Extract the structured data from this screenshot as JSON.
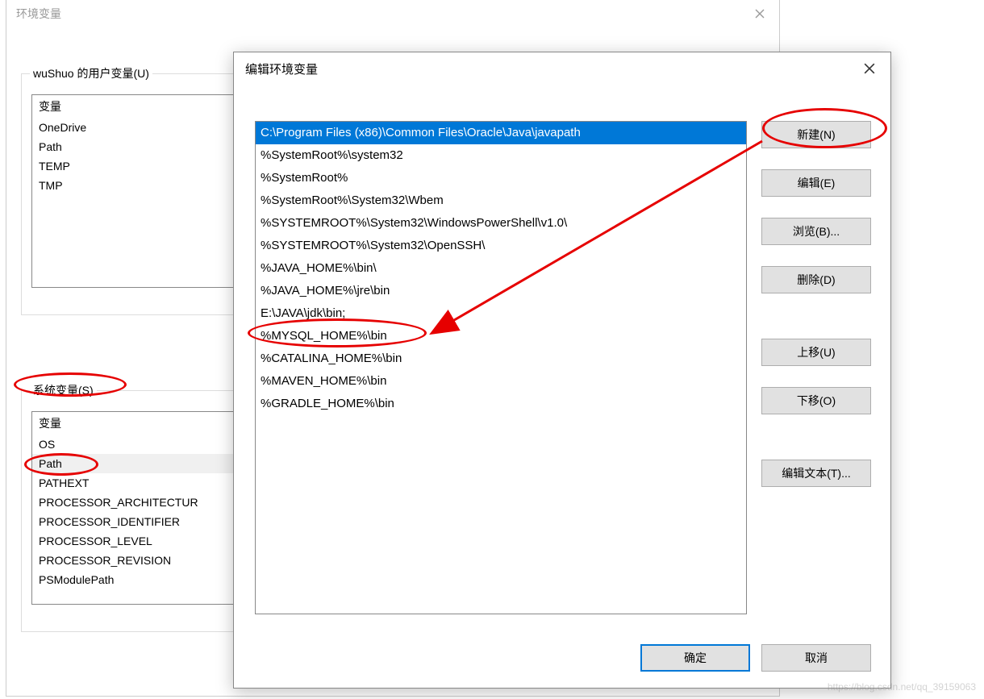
{
  "env_window": {
    "title": "环境变量",
    "user_vars_label": "wuShuo 的用户变量(U)",
    "sys_vars_label": "系统变量(S)",
    "header": "变量",
    "user_vars": [
      "OneDrive",
      "Path",
      "TEMP",
      "TMP"
    ],
    "sys_vars": [
      "OS",
      "Path",
      "PATHEXT",
      "PROCESSOR_ARCHITECTUR",
      "PROCESSOR_IDENTIFIER",
      "PROCESSOR_LEVEL",
      "PROCESSOR_REVISION",
      "PSModulePath"
    ],
    "sys_selected_index": 1
  },
  "edit_dialog": {
    "title": "编辑环境变量",
    "paths": [
      "C:\\Program Files (x86)\\Common Files\\Oracle\\Java\\javapath",
      "%SystemRoot%\\system32",
      "%SystemRoot%",
      "%SystemRoot%\\System32\\Wbem",
      "%SYSTEMROOT%\\System32\\WindowsPowerShell\\v1.0\\",
      "%SYSTEMROOT%\\System32\\OpenSSH\\",
      "%JAVA_HOME%\\bin\\",
      "%JAVA_HOME%\\jre\\bin",
      "E:\\JAVA\\jdk\\bin;",
      "%MYSQL_HOME%\\bin",
      "%CATALINA_HOME%\\bin",
      "%MAVEN_HOME%\\bin",
      "%GRADLE_HOME%\\bin"
    ],
    "selected_index": 0,
    "buttons": {
      "new": "新建(N)",
      "edit": "编辑(E)",
      "browse": "浏览(B)...",
      "delete": "删除(D)",
      "up": "上移(U)",
      "down": "下移(O)",
      "edit_text": "编辑文本(T)...",
      "ok": "确定",
      "cancel": "取消"
    }
  },
  "watermark": "https://blog.csdn.net/qq_39159063"
}
